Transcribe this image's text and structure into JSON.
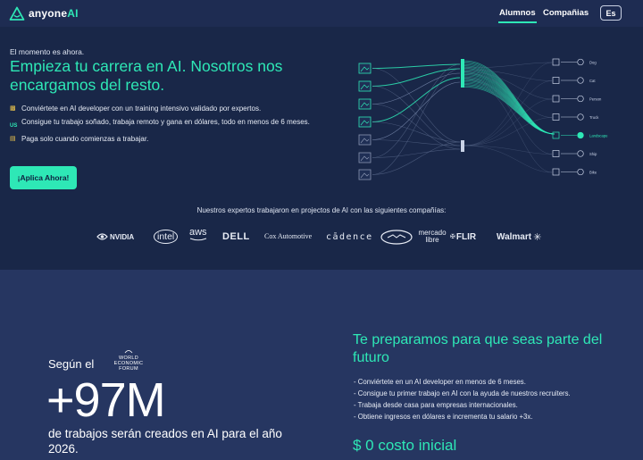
{
  "nav": {
    "logo_text": "anyone",
    "logo_ai": "AI",
    "links": [
      "Alumnos",
      "Compañias"
    ],
    "active_link": "Alumnos",
    "lang_button": "Es",
    "accent_color": "#2ee8b6"
  },
  "hero": {
    "eyebrow": "El momento es ahora.",
    "title": "Empieza tu carrera en AI. Nosotros nos encargamos del resto.",
    "bullets": [
      {
        "icon": "laptop-icon",
        "text": "Conviértete en AI developer con un training intensivo validado por expertos."
      },
      {
        "icon": "us-flag-icon",
        "icon_text": "US",
        "text": "Consigue tu trabajo soñado, trabaja remoto y gana en dólares, todo en menos de 6 meses."
      },
      {
        "icon": "wallet-icon",
        "text": "Paga solo cuando comienzas a trabajar."
      }
    ],
    "cta": "¡Aplica Ahora!",
    "viz": {
      "classes": [
        "Dog",
        "Cat",
        "Person",
        "Truck",
        "Landscape",
        "Ship",
        "Bike"
      ],
      "highlighted_class": "Landscape"
    }
  },
  "companies": {
    "intro": "Nuestros expertos trabajaron en projectos de AI con las siguientes compañías:",
    "logos": [
      "NVIDIA",
      "intel",
      "aws",
      "DELL",
      "Cox Automotive",
      "cādence",
      "mercado libre",
      "FLIR",
      "Walmart"
    ]
  },
  "stats": {
    "segun": "Según el",
    "wef": [
      "WORLD",
      "ECONOMIC",
      "FORUM"
    ],
    "number": "+97M",
    "description": "de trabajos serán creados en AI para el año 2026."
  },
  "prep": {
    "title": "Te preparamos para que seas parte del futuro",
    "items": [
      "Conviértete en un AI developer en menos de 6 meses.",
      "Consigue tu primer trabajo en AI con la ayuda de nuestros recruiters.",
      "Trabaja desde casa para empresas internacionales.",
      "Obtiene ingresos en dólares e incrementa tu salario +3x."
    ],
    "cost": "$ 0 costo inicial"
  }
}
